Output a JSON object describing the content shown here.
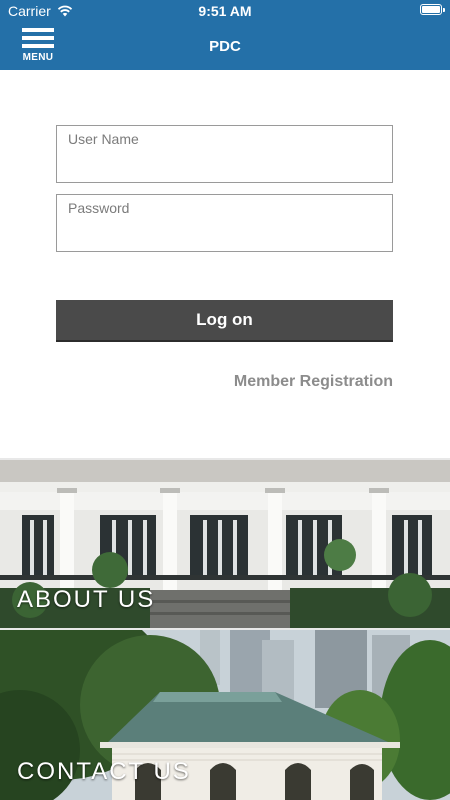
{
  "status_bar": {
    "carrier": "Carrier",
    "time": "9:51 AM"
  },
  "nav": {
    "menu_label": "MENU",
    "title": "PDC"
  },
  "login": {
    "username_label": "User Name",
    "username_value": "",
    "password_label": "Password",
    "password_value": "",
    "logon_label": "Log on",
    "member_registration": "Member Registration"
  },
  "panels": [
    {
      "label": "ABOUT US"
    },
    {
      "label": "CONTACT US"
    }
  ],
  "colors": {
    "brand": "#2470a8",
    "button": "#4a4a4a",
    "link": "#8c8c8c"
  }
}
